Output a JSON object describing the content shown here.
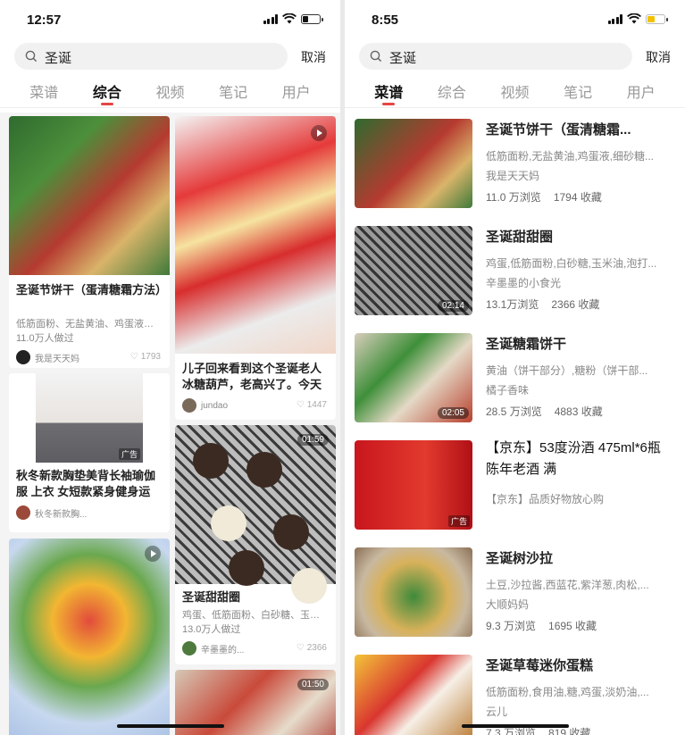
{
  "left": {
    "status": {
      "time": "12:57"
    },
    "search": {
      "query": "圣诞",
      "cancel": "取消"
    },
    "tabs": [
      "菜谱",
      "综合",
      "视频",
      "笔记",
      "用户"
    ],
    "active_tab_index": 1,
    "cards": [
      {
        "title": "圣诞节饼干（蛋清糖霜方法）",
        "desc": "低筋面粉、无盐黄油、鸡蛋液、细砂糖",
        "meta": "11.0万人做过",
        "user": "我是天天妈",
        "likes": "1793"
      },
      {
        "title": "秋冬新款胸垫美背长袖瑜伽服 上衣 女短款紧身健身运",
        "user": "秋冬新款胸...",
        "ad": "广告"
      },
      {
        "play": true
      },
      {
        "title": "儿子回来看到这个圣诞老人冰糖葫芦，老高兴了。今天",
        "user": "jundao",
        "likes": "1447",
        "play": true
      },
      {
        "title": "圣诞甜甜圈",
        "desc": "鸡蛋、低筋面粉、白砂糖、玉米油",
        "meta": "13.0万人做过",
        "user": "辛墨墨的...",
        "likes": "2366",
        "duration": "01:59"
      },
      {
        "duration": "01:50"
      }
    ]
  },
  "right": {
    "status": {
      "time": "8:55"
    },
    "search": {
      "query": "圣诞",
      "cancel": "取消"
    },
    "tabs": [
      "菜谱",
      "综合",
      "视频",
      "笔记",
      "用户"
    ],
    "active_tab_index": 0,
    "items": [
      {
        "title": "圣诞节饼干（蛋清糖霜...",
        "desc": "低筋面粉,无盐黄油,鸡蛋液,细砂糖...",
        "author": "我是天天妈",
        "views": "11.0 万浏览",
        "favs": "1794 收藏"
      },
      {
        "title": "圣诞甜甜圈",
        "desc": "鸡蛋,低筋面粉,白砂糖,玉米油,泡打...",
        "author": "辛墨墨的小食光",
        "views": "13.1万浏览",
        "favs": "2366 收藏",
        "duration": "02:14"
      },
      {
        "title": "圣诞糖霜饼干",
        "desc": "黄油（饼干部分）,糖粉（饼干部...",
        "author": "橘子香味",
        "views": "28.5 万浏览",
        "favs": "4883 收藏",
        "duration": "02:05"
      },
      {
        "title": "【京东】53度汾酒 475ml*6瓶 陈年老酒 满",
        "desc": "【京东】品质好物放心购",
        "ad": "广告"
      },
      {
        "title": "圣诞树沙拉",
        "desc": "土豆,沙拉酱,西蓝花,紫洋葱,肉松,...",
        "author": "大顺妈妈",
        "views": "9.3 万浏览",
        "favs": "1695 收藏"
      },
      {
        "title": "圣诞草莓迷你蛋糕",
        "desc": "低筋面粉,食用油,糖,鸡蛋,淡奶油,...",
        "author": "云儿",
        "views": "7.3 万浏览",
        "favs": "819 收藏"
      }
    ]
  },
  "colors": {
    "accent": "#e64545",
    "battery_left": "#111111",
    "battery_right": "#f2c200"
  }
}
